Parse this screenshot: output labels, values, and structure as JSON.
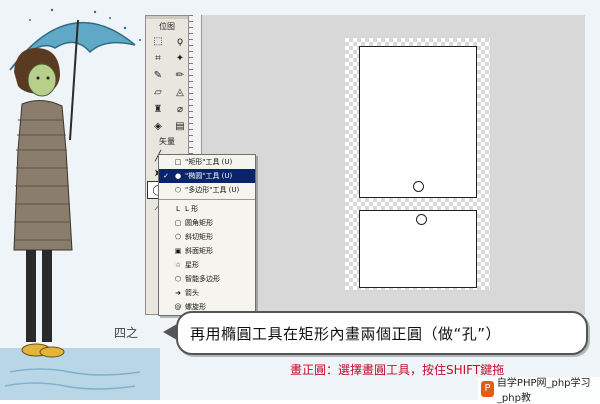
{
  "tools_panel": {
    "bitmap_section": "位图",
    "vector_section": "矢量",
    "tool_icons": [
      "marquee-icon",
      "lasso-icon",
      "crop-icon",
      "magic-wand-icon",
      "brush-icon",
      "pencil-icon",
      "eraser-icon",
      "blur-icon",
      "rubber-stamp-icon",
      "eyedropper-icon",
      "paint-bucket-icon",
      "line-icon",
      "pen-icon",
      "ellipse-icon",
      "text-icon"
    ]
  },
  "shape_menu": {
    "items": [
      {
        "label": "\"矩形\"工具 (U)",
        "checked": false,
        "selected": false
      },
      {
        "label": "\"椭圆\"工具 (U)",
        "checked": true,
        "selected": true
      },
      {
        "label": "\"多边形\"工具 (U)",
        "checked": false,
        "selected": false
      }
    ],
    "autoshapes": [
      "L 形",
      "圆角矩形",
      "斜切矩形",
      "斜面矩形",
      "星形",
      "智能多边形",
      "箭头",
      "螺旋形"
    ]
  },
  "caption": {
    "step": "四之",
    "text": "再用橢圓工具在矩形內畫兩個正圓（做“孔”）",
    "hint": "畫正圓：選擇畫圓工具，按住SHIFT鍵拖"
  },
  "watermark": {
    "logo": "P",
    "text": "自学PHP网_php学习_php教"
  },
  "colors": {
    "menu_highlight": "#0a246a",
    "hint_red": "#c0102e"
  }
}
